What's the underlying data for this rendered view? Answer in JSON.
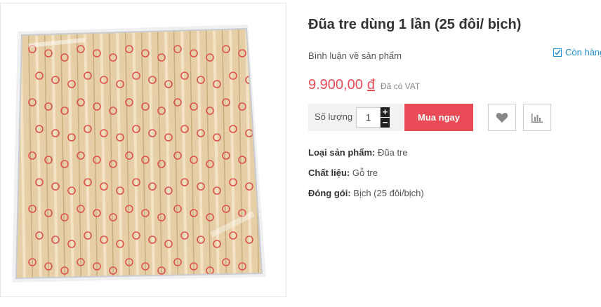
{
  "product": {
    "title": "Đũa tre dùng 1 lần (25 đôi/ bịch)",
    "review_link": "Bình luận về sản phẩm",
    "stock_status": "Còn hàng",
    "price": "9.900,00",
    "currency": "đ",
    "vat_note": "Đã có VAT"
  },
  "purchase": {
    "quantity_label": "Số lượng",
    "quantity": "1",
    "plus": "+",
    "minus": "−",
    "buy_label": "Mua ngay"
  },
  "attributes": [
    {
      "label": "Loại sản phẩm:",
      "value": "Đũa tre"
    },
    {
      "label": "Chất liệu:",
      "value": "Gỗ tre"
    },
    {
      "label": "Đóng gói:",
      "value": "Bịch (25 đôi/bịch)"
    }
  ],
  "icons": {
    "stock": "checkbox-check-icon",
    "wishlist": "heart-icon",
    "compare": "bar-chart-icon"
  },
  "colors": {
    "accent": "#e84b55",
    "link": "#1d8ecf"
  }
}
